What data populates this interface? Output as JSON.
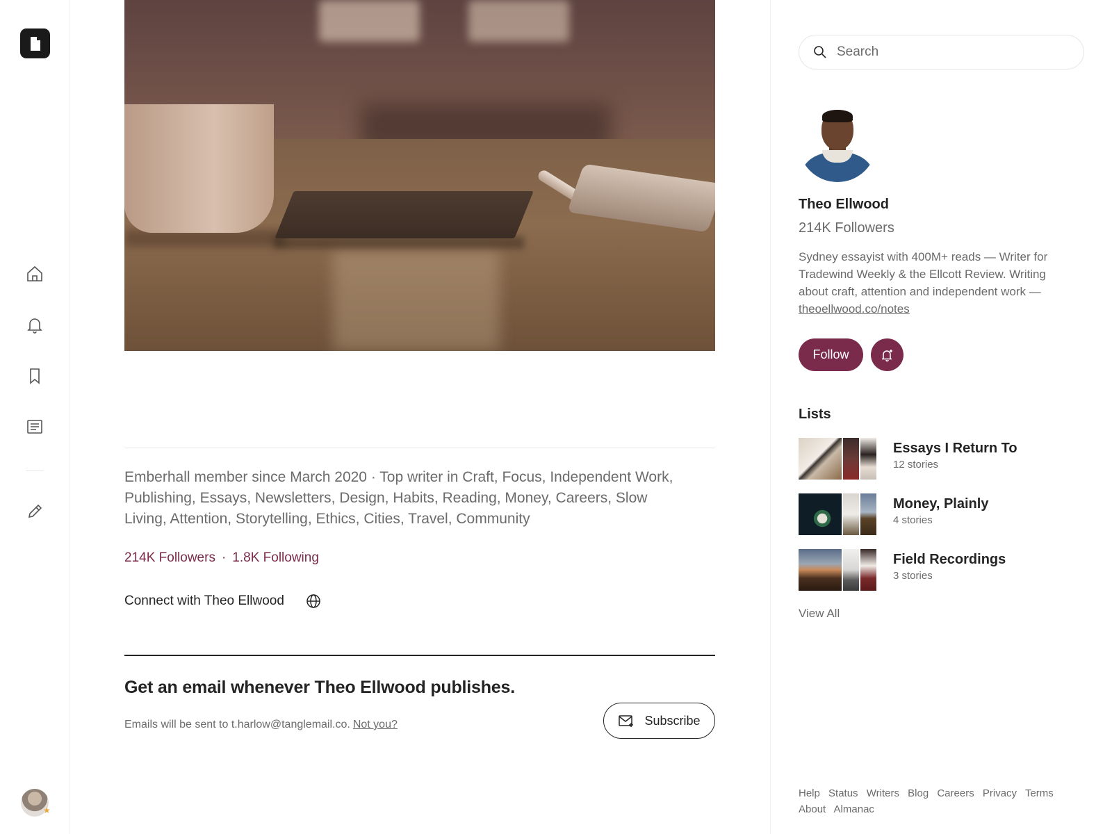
{
  "rail": {
    "logo": "medium-logo",
    "items": [
      "home",
      "notifications",
      "bookmarks",
      "stories",
      "write"
    ]
  },
  "main": {
    "member_line": "Emberhall member since March 2020  ·  Top writer in Craft, Focus, Independent Work, Publishing, Essays, Newsletters, Design, Habits, Reading, Money, Careers, Slow Living, Attention, Storytelling, Ethics, Cities, Travel, Community",
    "followers": "214K Followers",
    "following": "1.8K Following",
    "stats_sep": "·",
    "connect_label": "Connect with Theo Ellwood",
    "subscribe_title": "Get an email whenever Theo Ellwood publishes.",
    "subscribe_note": "Emails will be sent to t.harlow@tanglemail.co.",
    "not_you": "Not you?",
    "subscribe_button": "Subscribe"
  },
  "sidebar": {
    "search_placeholder": "Search",
    "name": "Theo Ellwood",
    "followers": "214K Followers",
    "bio": "Sydney essayist with 400M+ reads — Writer for Tradewind Weekly & the Ellcott Review. Writing about craft, attention and independent work — ",
    "bio_link": "theoellwood.co/notes",
    "follow_button": "Follow",
    "lists_title": "Lists",
    "lists": [
      {
        "name": "Essays I Return To",
        "count": "12 stories"
      },
      {
        "name": "Money, Plainly",
        "count": "4 stories"
      },
      {
        "name": "Field Recordings",
        "count": "3 stories"
      }
    ],
    "view_all": "View All",
    "footer": [
      "Help",
      "Status",
      "Writers",
      "Blog",
      "Careers",
      "Privacy",
      "Terms",
      "About",
      "Almanac"
    ]
  },
  "colors": {
    "accent": "#7a2a4a",
    "text": "#242424",
    "muted": "#6b6b6b"
  }
}
